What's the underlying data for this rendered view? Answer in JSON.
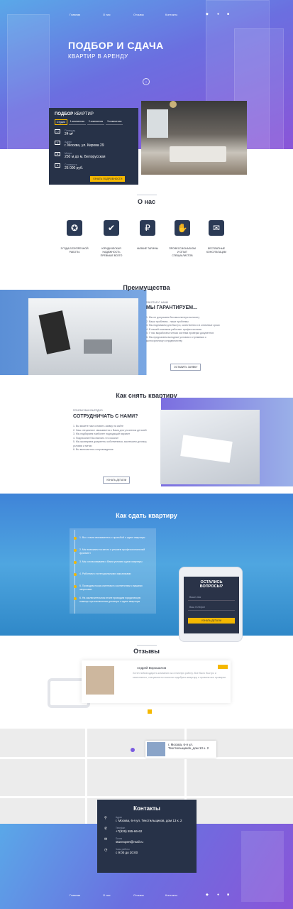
{
  "nav": {
    "items": [
      "Главная",
      "О нас",
      "Отзывы",
      "Контакты"
    ],
    "icons": [
      "vk-icon",
      "viber-icon",
      "instagram-icon"
    ]
  },
  "hero": {
    "title": "ПОДБОР И СДАЧА",
    "subtitle": "КВАРТИР В АРЕНДУ"
  },
  "selection": {
    "title_bold": "ПОДБОР",
    "title_rest": " КВАРТИР",
    "tabs": [
      "Студия",
      "1-комнатная",
      "2-комнатная",
      "3-комнатная"
    ],
    "area_label": "Площадь",
    "area_value": "24 м²",
    "address_label": "Адрес",
    "address_value": "г. Москва, ул. Кирова 29",
    "metro_label": "Метро",
    "metro_value": "250 м до м. Белорусская",
    "price_label": "Стоимость",
    "price_value": "25 000 руб.",
    "button": "УЗНАТЬ ПОДРОБНОСТИ"
  },
  "about": {
    "title": "О нас",
    "features": [
      "3 ГОДА БЕЗУПРЕЧНОЙ РАБОТЫ",
      "ЮРИДИЧЕСКАЯ НАДЕЖНОСТЬ ПРЕВЫШЕ ВСЕГО",
      "НИЗКИЕ ТАРИФЫ",
      "ПРОФЕССИОНАЛИЗМ И ОПЫТ СПЕЦИАЛИСТОВ",
      "БЕСПЛАТНЫЕ КОНСУЛЬТАЦИИ"
    ]
  },
  "advantages": {
    "title": "Преимущества",
    "kicker": "РАБОТАЯ С НАМИ",
    "heading": "МЫ ГАРАНТИРУЕМ...",
    "items": [
      "1. Мы не допускаем бессмысленную волокиту",
      "2. Ваши проблемы - наши проблемы",
      "3. Мы поднимаем для быстро, качественно и в ключевые сроки",
      "4. В нашей компании работают профессионалы",
      "5. У нас выработана четкая система проверки документов",
      "6. Мы предлагаем выгодные условия и стремимся к долгосрочному сотрудничеству"
    ],
    "button": "ОСТАВИТЬ ЗАЯВКУ"
  },
  "rent": {
    "title": "Как снять квартиру",
    "kicker": "ПОЧЕМУ ВАМ ВЫГОДНО",
    "heading": "СОТРУДНИЧАТЬ С НАМИ?",
    "items": [
      "1. Вы можете нам оставить заявку на сайте",
      "2. Наш специалист связывается с Вами для уточнения деталей",
      "3. Мы подбираем наиболее подходящий вариант",
      "4. Подписание! Вы въехать что искали!",
      "5. Мы проверяем документы собственника, заключаем договор, условия и метки",
      "6. Вы включаетесь сопровождение"
    ],
    "button": "УЗНАТЬ ДЕТАЛИ"
  },
  "lease": {
    "title": "Как сдать квартиру",
    "steps": [
      "1. Вы с нами связываетесь с просьбой о сдаче квартиры",
      "2. Мы выезжаем на место и решаем профессиональный фрагмент",
      "3. Мы согласовываем с Вами условия сдачи квартиры",
      "4. Работаем с потенциальными заказчиками",
      "5. Проводим показ клиентам в соответствии с вашими запросами",
      "6. На заключительном этапе проводим юридическую помощь при заключении договора о сдаче квартиры"
    ],
    "phone": {
      "title1": "ОСТАЛИСЬ",
      "title2": "ВОПРОСЫ?",
      "name_ph": "Ваше имя",
      "phone_ph": "Ваш телефон",
      "button": "УЗНАТЬ ДЕТАЛИ"
    }
  },
  "reviews": {
    "title": "Отзывы",
    "name": "Андрей Ворошилов",
    "text": "Хотел поблагодарить компанию за отличную работу. Все было быстро и качественно, специалисты помогли подобрать квартиру и провели все проверки."
  },
  "map": {
    "address": "г. Москва, 6-я ул. Текстильщиков, дом 13 к. 2"
  },
  "contacts": {
    "title": "Контакты",
    "address_label": "Адрес",
    "address_value": "г. Москва, 6-я ул. Текстильщиков, дом 13 к. 2",
    "phone_label": "Телефон",
    "phone_value": "+7(926) 555-66-62",
    "email_label": "Почта",
    "email_value": "stavexpert@mail.ru",
    "hours_label": "Часы работы",
    "hours_value": "с 9:00 до 20:00"
  },
  "colors": {
    "accent": "#f5b800",
    "dark": "#273248"
  }
}
